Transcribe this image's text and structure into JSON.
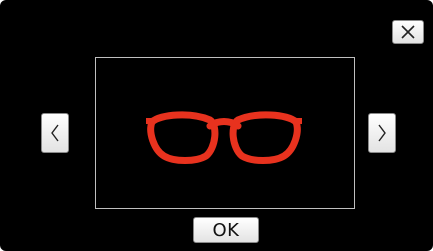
{
  "dialog": {
    "ok_label": "OK"
  },
  "icons": {
    "close": "close-icon",
    "prev": "chevron-left-icon",
    "next": "chevron-right-icon",
    "preview": "glasses-icon"
  },
  "colors": {
    "background": "#000000",
    "button_face": "#f2f2f2",
    "frame_border": "#bfbfbf",
    "glasses": "#e8321e"
  }
}
